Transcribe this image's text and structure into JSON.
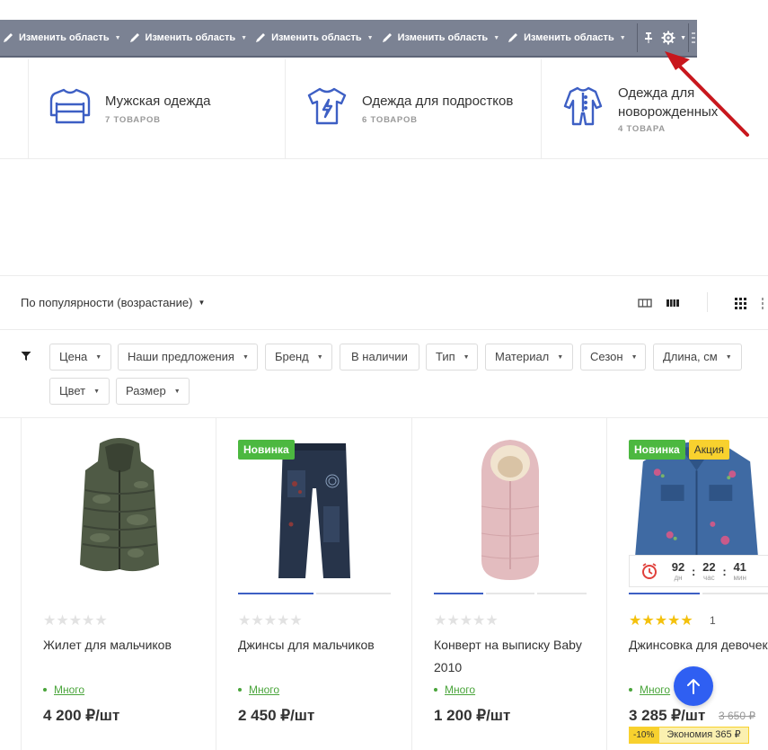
{
  "admin_bar": {
    "edit_items": [
      "Изменить область",
      "Изменить область",
      "Изменить область",
      "Изменить область",
      "Изменить область"
    ],
    "pin_icon": "pin-icon",
    "settings_icon": "gear-icon"
  },
  "categories": [
    {
      "title": "Мужская одежда",
      "count": "7 ТОВАРОВ",
      "icon": "sweater-icon"
    },
    {
      "title": "Одежда для подростков",
      "count": "6 ТОВАРОВ",
      "icon": "tshirt-icon"
    },
    {
      "title": "Одежда для новорожденных",
      "count": "4 ТОВАРА",
      "icon": "onesie-icon"
    }
  ],
  "sort": {
    "label": "По популярности (возрастание)"
  },
  "filters": [
    {
      "label": "Цена",
      "caret": true
    },
    {
      "label": "Наши предложения",
      "caret": true
    },
    {
      "label": "Бренд",
      "caret": true
    },
    {
      "label": "В наличии",
      "caret": false
    },
    {
      "label": "Тип",
      "caret": true
    },
    {
      "label": "Материал",
      "caret": true
    },
    {
      "label": "Сезон",
      "caret": true
    },
    {
      "label": "Длина, см",
      "caret": true
    },
    {
      "label": "Цвет",
      "caret": true
    },
    {
      "label": "Размер",
      "caret": true
    }
  ],
  "products": [
    {
      "name": "Жилет для мальчиков",
      "price": "4 200 ₽/шт",
      "stock": "Много",
      "stars": "★★★★★",
      "rating": 0,
      "badges": []
    },
    {
      "name": "Джинсы для мальчиков",
      "price": "2 450 ₽/шт",
      "stock": "Много",
      "stars": "★★★★★",
      "rating": 0,
      "badges": [
        "Новинка"
      ]
    },
    {
      "name": "Конверт на выписку Baby 2010",
      "price": "1 200 ₽/шт",
      "stock": "Много",
      "stars": "★★★★★",
      "rating": 0,
      "badges": []
    },
    {
      "name": "Джинсовка для девочек",
      "price": "3 285 ₽/шт",
      "old_price": "3 650 ₽",
      "stock": "Много",
      "stars": "★★★★★",
      "rating": 5,
      "rating_count": "1",
      "badges": [
        "Новинка",
        "Акция"
      ]
    }
  ],
  "timer": {
    "days": "92",
    "days_lbl": "дн",
    "hours": "22",
    "hours_lbl": "час",
    "minutes": "41",
    "minutes_lbl": "мин"
  },
  "discount": {
    "percent": "-10%",
    "saving": "Экономия 365 ₽"
  },
  "colors": {
    "toolbar": "#7b8293",
    "accent": "#3d5fc4",
    "badge_new": "#4cb840",
    "badge_sale": "#f8d12e",
    "stock": "#4aa53b",
    "annotation_arrow": "#c8171d",
    "scroll_up": "#2f5ff2"
  }
}
